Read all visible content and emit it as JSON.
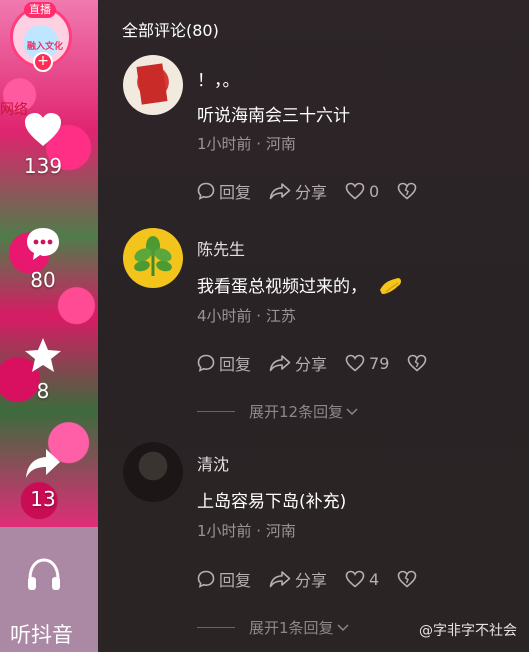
{
  "sidebar": {
    "live_badge": "直播",
    "live_avatar_text": "融入文化",
    "follow_icon": "+",
    "partner_tag": "网络",
    "like_count": "139",
    "comment_count": "80",
    "favorite_count": "8",
    "share_count": "13",
    "listen_label": "听抖音"
  },
  "panel": {
    "title": "全部评论(80)"
  },
  "comments": [
    {
      "content_line1": "！，。",
      "content": "听说海南会三十六计",
      "meta": "1小时前 · 河南",
      "reply_label": "回复",
      "share_label": "分享",
      "like_count": "0"
    },
    {
      "username": "陈先生",
      "content": "我看蛋总视频过来的，",
      "meta": "4小时前 · 江苏",
      "reply_label": "回复",
      "share_label": "分享",
      "like_count": "79",
      "expand_label": "展开12条回复"
    },
    {
      "username": "清沈",
      "content": "上岛容易下岛(补充)",
      "meta": "1小时前 · 河南",
      "reply_label": "回复",
      "share_label": "分享",
      "like_count": "4",
      "expand_label": "展开1条回复"
    }
  ],
  "watermark": "@字非字不社会"
}
